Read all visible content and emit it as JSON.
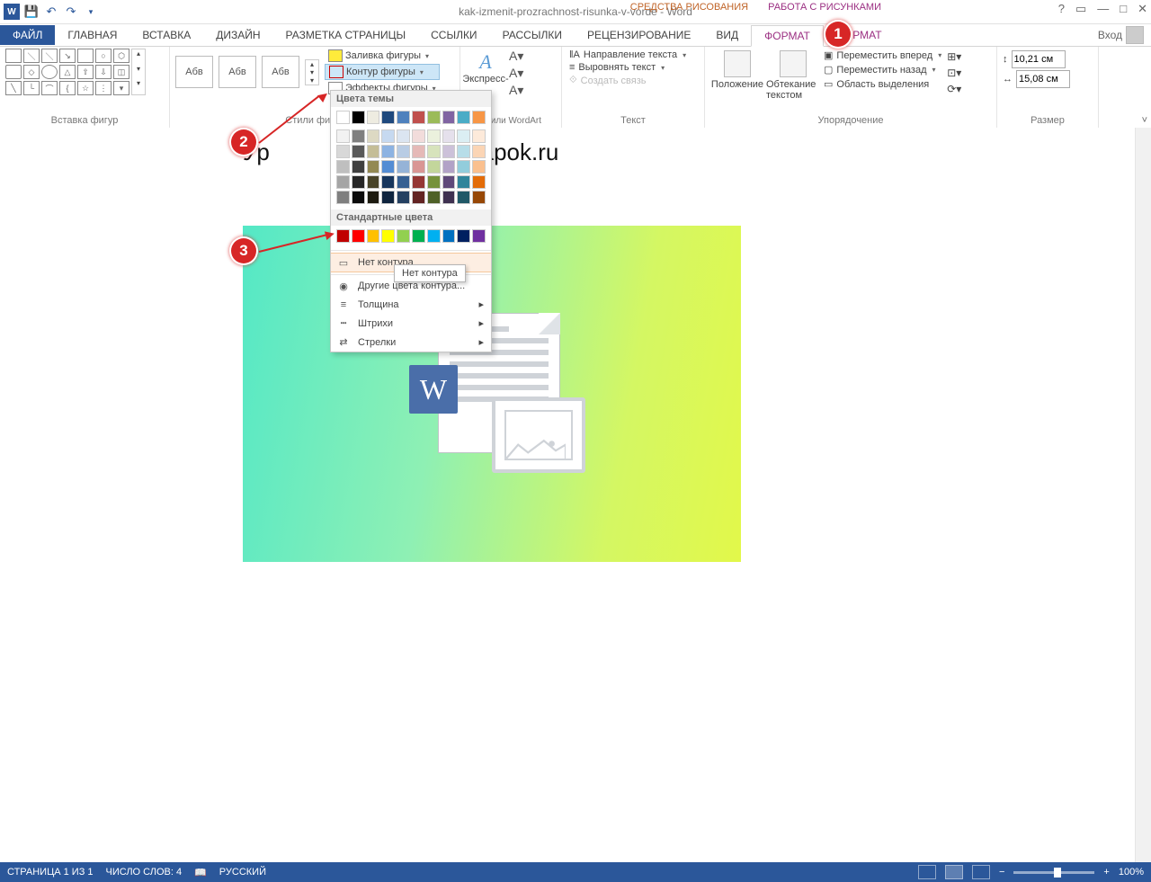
{
  "title": "kak-izmenit-prozrachnost-risunka-v-vorde - Word",
  "tool_tabs": {
    "drawing": "СРЕДСТВА РИСОВАНИЯ",
    "picture": "РАБОТА С РИСУНКАМИ"
  },
  "tabs": {
    "file": "ФАЙЛ",
    "home": "ГЛАВНАЯ",
    "insert": "ВСТАВКА",
    "design": "ДИЗАЙН",
    "layout": "РАЗМЕТКА СТРАНИЦЫ",
    "refs": "ССЫЛКИ",
    "mail": "РАССЫЛКИ",
    "review": "РЕЦЕНЗИРОВАНИЕ",
    "view": "ВИД",
    "format1": "ФОРМАТ",
    "format2": "ФОРМАТ"
  },
  "login": "Вход",
  "groups": {
    "shapes": "Вставка фигур",
    "styles": "Стили фигур",
    "wordart": "Стили WordArt",
    "text": "Текст",
    "arrange": "Упорядочение",
    "size": "Размер"
  },
  "style_thumb": "Абв",
  "fill": {
    "fill": "Заливка фигуры",
    "outline": "Контур фигуры",
    "effects": "Эффекты фигуры"
  },
  "express": "Экспресс-",
  "wordart_cmds": {
    "a": "A",
    "b": "A",
    "c": "A"
  },
  "text_cmds": {
    "dir": "Направление текста",
    "align": "Выровнять текст",
    "link": "Создать связь"
  },
  "arrange": {
    "pos": "Положение",
    "wrap": "Обтекание текстом",
    "fwd": "Переместить вперед",
    "back": "Переместить назад",
    "sel": "Область выделения"
  },
  "size": {
    "h": "10,21 см",
    "w": "15,08 см"
  },
  "page_heading_left": "Ур",
  "page_heading_right": "aratapok.ru",
  "dropdown": {
    "theme": "Цвета темы",
    "standard": "Стандартные цвета",
    "none": "Нет контура",
    "more": "Другие цвета контура...",
    "weight": "Толщина",
    "dashes": "Штрихи",
    "arrows": "Стрелки"
  },
  "tooltip": "Нет контура",
  "theme_colors_row1": [
    "#ffffff",
    "#000000",
    "#eeece1",
    "#1f497d",
    "#4f81bd",
    "#c0504d",
    "#9bbb59",
    "#8064a2",
    "#4bacc6",
    "#f79646"
  ],
  "theme_tints": [
    [
      "#f2f2f2",
      "#7f7f7f",
      "#ddd9c3",
      "#c6d9f0",
      "#dbe5f1",
      "#f2dcdb",
      "#ebf1dd",
      "#e5e0ec",
      "#dbeef3",
      "#fdeada"
    ],
    [
      "#d8d8d8",
      "#595959",
      "#c4bd97",
      "#8db3e2",
      "#b8cce4",
      "#e5b9b7",
      "#d7e3bc",
      "#ccc1d9",
      "#b7dde8",
      "#fbd5b5"
    ],
    [
      "#bfbfbf",
      "#3f3f3f",
      "#938953",
      "#548dd4",
      "#95b3d7",
      "#d99694",
      "#c3d69b",
      "#b2a2c7",
      "#92cddc",
      "#fac08f"
    ],
    [
      "#a5a5a5",
      "#262626",
      "#494429",
      "#17365d",
      "#366092",
      "#953734",
      "#76923c",
      "#5f497a",
      "#31859b",
      "#e36c09"
    ],
    [
      "#7f7f7f",
      "#0c0c0c",
      "#1d1b10",
      "#0f243e",
      "#244061",
      "#632423",
      "#4f6128",
      "#3f3151",
      "#205867",
      "#974806"
    ]
  ],
  "standard_colors": [
    "#c00000",
    "#ff0000",
    "#ffc000",
    "#ffff00",
    "#92d050",
    "#00b050",
    "#00b0f0",
    "#0070c0",
    "#002060",
    "#7030a0"
  ],
  "status": {
    "page": "СТРАНИЦА 1 ИЗ 1",
    "words": "ЧИСЛО СЛОВ: 4",
    "lang": "РУССКИЙ",
    "zoom": "100%"
  }
}
